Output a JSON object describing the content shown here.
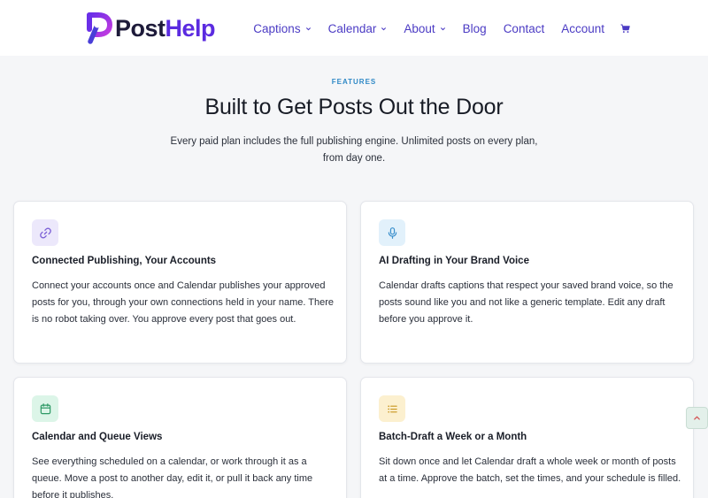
{
  "brand": {
    "name_part1": "Post",
    "name_part2": "Help",
    "colors": {
      "dark": "#1e1b3a",
      "accent": "#5b2be0",
      "nav": "#4b3bc4"
    }
  },
  "nav": {
    "items": [
      {
        "label": "Captions",
        "dropdown": true
      },
      {
        "label": "Calendar",
        "dropdown": true
      },
      {
        "label": "About",
        "dropdown": true
      },
      {
        "label": "Blog",
        "dropdown": false
      },
      {
        "label": "Contact",
        "dropdown": false
      },
      {
        "label": "Account",
        "dropdown": false
      }
    ],
    "cart_icon": "cart-icon"
  },
  "section": {
    "eyebrow": "FEATURES",
    "title": "Built to Get Posts Out the Door",
    "subtitle": "Every paid plan includes the full publishing engine. Unlimited posts on every plan, from day one."
  },
  "features": [
    {
      "icon": "link-icon",
      "icon_bg": "#ece8fb",
      "icon_color": "#7b5fd6",
      "title": "Connected Publishing, Your Accounts",
      "body": "Connect your accounts once and Calendar publishes your approved posts for you, through your own connections held in your name. There is no robot taking over. You approve every post that goes out."
    },
    {
      "icon": "microphone-icon",
      "icon_bg": "#e2f1fb",
      "icon_color": "#3a8fcc",
      "title": "AI Drafting in Your Brand Voice",
      "body": "Calendar drafts captions that respect your saved brand voice, so the posts sound like you and not like a generic template. Edit any draft before you approve it."
    },
    {
      "icon": "calendar-icon",
      "icon_bg": "#dcf5e8",
      "icon_color": "#2e9a66",
      "title": "Calendar and Queue Views",
      "body": "See everything scheduled on a calendar, or work through it as a queue. Move a post to another day, edit it, or pull it back any time before it publishes."
    },
    {
      "icon": "list-icon",
      "icon_bg": "#fcf0cf",
      "icon_color": "#c8951e",
      "title": "Batch-Draft a Week or a Month",
      "body": "Sit down once and let Calendar draft a whole week or month of posts at a time. Approve the batch, set the times, and your schedule is filled."
    }
  ],
  "scroll_top": {
    "icon": "chevron-up-icon"
  }
}
